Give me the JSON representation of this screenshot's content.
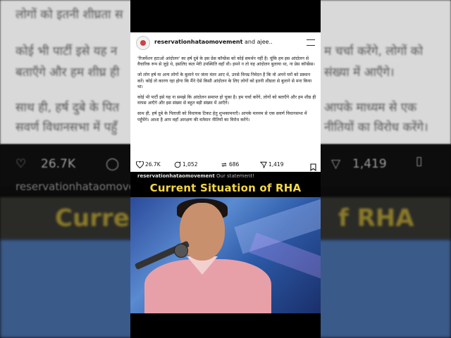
{
  "background": {
    "line1": "लोगों को इतनी शीघ्रता स",
    "line2": "कोई भी पार्टी इसे यह न",
    "line2_right": "म चर्चा करेंगे, लोगों को",
    "line3": "बताएँगे और हम शीघ्र ही",
    "line3_right": "संख्या में आएँगे।",
    "line4": "साथ ही, हर्ष दुबे के पित",
    "line4_right": "आपके माध्यम से एक",
    "line5": "सवर्ण विधानसभा में पहुँ",
    "line5_right": "नीतियों का विरोध करेंगे।",
    "likes": "26.7K",
    "shares": "1,419",
    "username": "reservationhataomovement",
    "title_left": "Curre",
    "title_right": "f RHA"
  },
  "post": {
    "author": "reservationhataomovement",
    "coauthor_text": "and ajee..",
    "paragraphs": [
      "'रिजर्वेशन हटाओ आंदोलन' का हर्ष दुबे के इस प्रेस कॉन्फ्रेंस को कोई समर्थन नहीं है। चूंकि हम इस आंदोलन से वैचारिक रूप से जुड़े थे, इसलिए कल मेरी उपस्थिति वहाँ थी। हमने न तो यह आंदोलन बुलाया था, ना प्रेस कॉन्फ्रेंस।",
      "जो लोग हर्ष या अन्य लोगों के बुलाने पर जंतर मंतर आए थे, उनसे विनम्र निवेदन है कि वो अपने घरों को प्रस्थान करें। कोई तो कारण रहा होगा कि मैंने ऐसे किसी आंदोलन के लिए लोगों को इतनी शीघ्रता से बुलाने से मना किया था।",
      "कोई भी पार्टी इसे यह ना समझे कि आंदोलन समाप्त हो चुका है। हम चर्चा करेंगे, लोगों को बताएँगे और हम शीघ्र ही वापस आएँगे और इस संख्या से बहुत बड़ी संख्या में आएँगे।",
      "साथ ही, हर्ष दुबे के पिताजी को विधायक टिकट हेतु शुभकामनाएँ। आपके माध्यम से एक सवर्ण विधानसभा में पहुँचेंगे। आशा है आप वहाँ आरक्षण की वर्तमान नीतियों का विरोध करेंगे।"
    ],
    "likes": "26.7K",
    "comments": "1,052",
    "reposts": "686",
    "shares": "1,419",
    "caption_user": "reservationhataomovement",
    "caption_text": "Our statement!"
  },
  "overlay_title": "Current Situation of RHA",
  "colors": {
    "overlay_title": "#f5d742",
    "panel_bg": "#000000"
  }
}
